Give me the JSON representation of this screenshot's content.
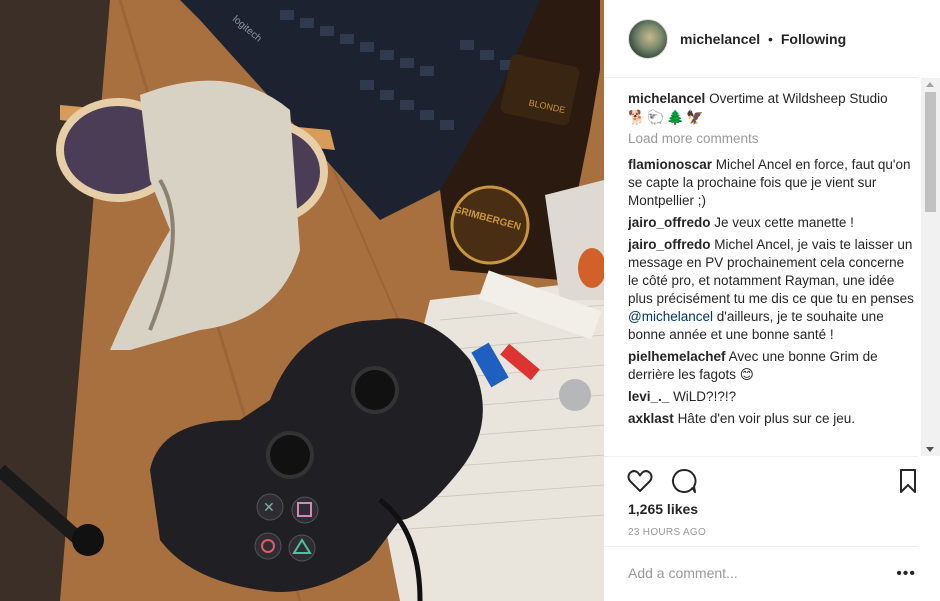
{
  "header": {
    "username": "michelancel",
    "separator": "•",
    "follow_status": "Following"
  },
  "caption": {
    "user": "michelancel",
    "text": "Overtime at Wildsheep Studio",
    "emojis": "🐕🐑🌲🦅"
  },
  "load_more": "Load more comments",
  "comments": [
    {
      "user": "flamionoscar",
      "text": "Michel Ancel en force, faut qu'on se capte la prochaine fois que je vient sur Montpellier ;)"
    },
    {
      "user": "jairo_offredo",
      "text": "Je veux cette manette !"
    },
    {
      "user": "jairo_offredo",
      "text_before": "Michel Ancel, je vais te laisser un message en PV prochainement cela concerne le côté pro, et notamment Rayman, une idée plus précisément tu me dis ce que tu en penses",
      "mention": "@michelancel",
      "text_after": "d'ailleurs, je te souhaite une bonne année et une bonne santé !"
    },
    {
      "user": "pielhemelachef",
      "text": "Avec une bonne Grim de derrière les fagots 😊"
    },
    {
      "user": "levi_._",
      "text": "WiLD?!?!?"
    },
    {
      "user": "axklast",
      "text": "Hâte d'en voir plus sur ce jeu."
    }
  ],
  "likes": "1,265 likes",
  "timestamp": "23 HOURS AGO",
  "add_comment_placeholder": "Add a comment...",
  "more_options": "•••",
  "photo": {
    "keyboard_brand": "logitech",
    "bottle_brand": "GRIMBERGEN",
    "bottle_label": "BLONDE"
  }
}
